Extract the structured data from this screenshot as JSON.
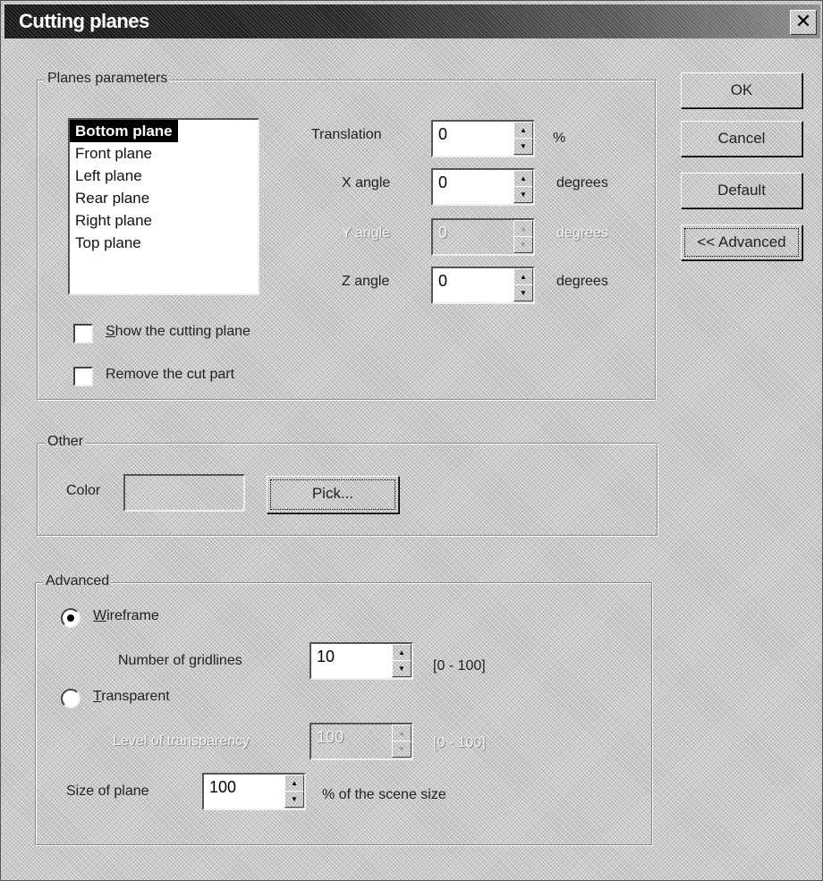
{
  "window": {
    "title": "Cutting planes",
    "close_glyph": "✕"
  },
  "buttons": {
    "ok": "OK",
    "cancel": "Cancel",
    "default": "Default",
    "advanced": "<< Advanced"
  },
  "planes_group": {
    "legend": "Planes parameters",
    "list": [
      "Bottom plane",
      "Front plane",
      "Left plane",
      "Rear plane",
      "Right plane",
      "Top plane"
    ],
    "selected_index": 0,
    "translation": {
      "label": "Translation",
      "value": "0",
      "unit": "%"
    },
    "x_angle": {
      "label": "X angle",
      "value": "0",
      "unit": "degrees"
    },
    "y_angle": {
      "label": "Y angle",
      "value": "0",
      "unit": "degrees",
      "disabled": true
    },
    "z_angle": {
      "label": "Z angle",
      "value": "0",
      "unit": "degrees"
    },
    "show_plane": {
      "label_first": "S",
      "label_rest": "how the cutting plane",
      "checked": false
    },
    "remove_cut": {
      "label": "Remove the cut part",
      "checked": false
    }
  },
  "other_group": {
    "legend": "Other",
    "color_label": "Color",
    "pick_label": "Pick..."
  },
  "advanced_group": {
    "legend": "Advanced",
    "wireframe": {
      "label_first": "W",
      "label_rest": "ireframe",
      "selected": true
    },
    "gridlines": {
      "label": "Number of gridlines",
      "value": "10",
      "range": "[0 - 100]"
    },
    "transparent": {
      "label_first": "T",
      "label_rest": "ransparent",
      "selected": false
    },
    "transparency": {
      "label": "Level of transparency",
      "value": "100",
      "range": "[0 - 100]",
      "disabled": true
    },
    "size": {
      "label": "Size of plane",
      "value": "100",
      "unit": "% of the scene size"
    }
  }
}
